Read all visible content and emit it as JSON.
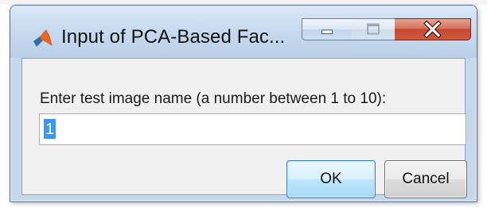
{
  "window": {
    "title": "Input of PCA-Based Fac...",
    "icon": "matlab-logo-icon",
    "controls": {
      "minimize_icon": "minimize-icon",
      "maximize_icon": "maximize-icon",
      "close_icon": "close-icon"
    }
  },
  "dialog": {
    "prompt": "Enter test image name (a number between 1 to 10):",
    "input_value": "1",
    "ok_label": "OK",
    "cancel_label": "Cancel"
  },
  "colors": {
    "titlebar": "#c8dbef",
    "client_background": "#f0f0f0",
    "close_button": "#c74630",
    "selection_highlight": "#3399ff",
    "default_button": "#bee6fd"
  }
}
